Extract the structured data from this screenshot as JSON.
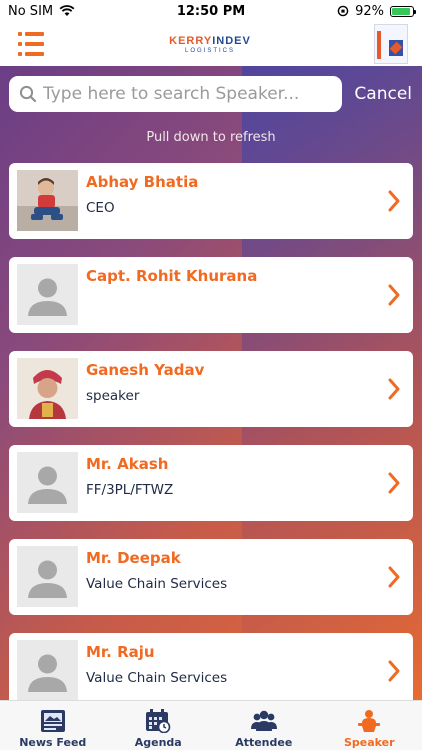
{
  "status_bar": {
    "carrier": "No SIM",
    "time": "12:50 PM",
    "battery": "92%"
  },
  "header": {
    "logo_brand_a": "KERRY",
    "logo_brand_b": "INDEV",
    "logo_sub": "LOGISTICS"
  },
  "search": {
    "placeholder": "Type here to search Speaker...",
    "cancel_label": "Cancel"
  },
  "refresh_hint": "Pull down to refresh",
  "speakers": [
    {
      "name": "Abhay Bhatia",
      "role": "CEO"
    },
    {
      "name": "Capt. Rohit Khurana",
      "role": ""
    },
    {
      "name": "Ganesh Yadav",
      "role": "speaker"
    },
    {
      "name": "Mr. Akash",
      "role": "FF/3PL/FTWZ"
    },
    {
      "name": "Mr. Deepak",
      "role": "Value Chain Services"
    },
    {
      "name": "Mr. Raju",
      "role": "Value Chain Services"
    }
  ],
  "tabs": [
    {
      "label": "News Feed",
      "icon": "newspaper-icon"
    },
    {
      "label": "Agenda",
      "icon": "calendar-icon"
    },
    {
      "label": "Attendee",
      "icon": "group-icon"
    },
    {
      "label": "Speaker",
      "icon": "speaker-podium-icon"
    }
  ],
  "colors": {
    "accent": "#f06a22",
    "navy": "#2a3a63"
  }
}
